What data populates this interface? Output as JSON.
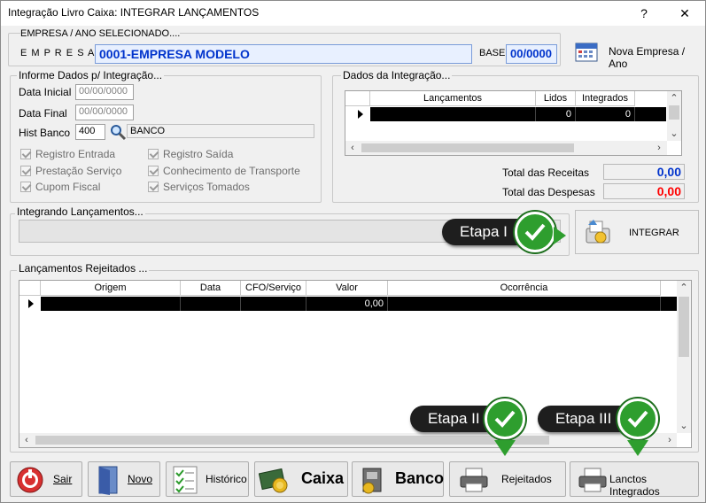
{
  "window": {
    "title": "Integração Livro Caixa: INTEGRAR LANÇAMENTOS",
    "help": "?",
    "close": "✕"
  },
  "empresa": {
    "header": "EMPRESA  /  ANO  SELECIONADO....",
    "label": "E M P R E S A",
    "value": "0001-EMPRESA MODELO",
    "base_label": "BASE",
    "base_value": "00/0000",
    "nova_button": "Nova Empresa / Ano"
  },
  "informe": {
    "group_label": "Informe Dados p/ Integração...",
    "data_inicial_label": "Data Inicial",
    "data_inicial": "00/00/0000",
    "data_final_label": "Data Final",
    "data_final": "00/00/0000",
    "hist_banco_label": "Hist Banco",
    "hist_banco": "400",
    "hist_banco_desc": "BANCO",
    "checks": [
      "Registro Entrada",
      "Registro Saída",
      "Prestação Serviço",
      "Conhecimento de Transporte",
      "Cupom Fiscal",
      "Serviços Tomados"
    ]
  },
  "dados": {
    "group_label": "Dados da Integração...",
    "columns": [
      "Lançamentos",
      "Lidos",
      "Integrados"
    ],
    "row": [
      "",
      "0",
      "0"
    ],
    "receitas_label": "Total das Receitas",
    "receitas_value": "0,00",
    "despesas_label": "Total das Despesas",
    "despesas_value": "0,00"
  },
  "integrando": {
    "group_label": "Integrando Lançamentos...",
    "integrar_button": "INTEGRAR"
  },
  "rejeitados": {
    "group_label": "Lançamentos Rejeitados ...",
    "columns": [
      "Origem",
      "Data",
      "CFO/Serviço",
      "Valor",
      "Ocorrência"
    ],
    "row": [
      "",
      "",
      "",
      "0,00",
      ""
    ]
  },
  "callouts": {
    "etapa1": "Etapa I",
    "etapa2": "Etapa II",
    "etapa3": "Etapa III"
  },
  "buttons": {
    "sair": "Sair",
    "novo": "Novo",
    "historico": "Histórico",
    "caixa": "Caixa",
    "banco": "Banco",
    "rejeitados": "Rejeitados",
    "lanctos": "Lanctos Integrados"
  },
  "colors": {
    "receitas": "#0033cc",
    "despesas": "#ff0000",
    "callout_bg": "#1e1e1e",
    "badge_green": "#2e9e2e"
  }
}
